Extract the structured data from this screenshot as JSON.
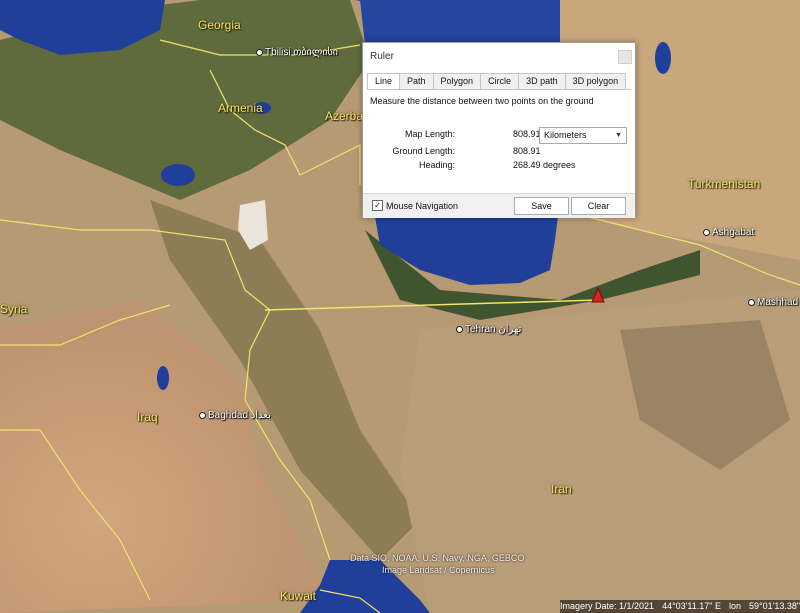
{
  "map": {
    "countries": [
      {
        "id": "georgia",
        "label": "Georgia"
      },
      {
        "id": "armenia",
        "label": "Armenia"
      },
      {
        "id": "azerbaijan",
        "label": "Azerba"
      },
      {
        "id": "turkmenistan",
        "label": "Turkmenistan"
      },
      {
        "id": "syria",
        "label": "Syria"
      },
      {
        "id": "iraq",
        "label": "Iraq"
      },
      {
        "id": "iran",
        "label": "Iran"
      },
      {
        "id": "kuwait",
        "label": "Kuwait"
      }
    ],
    "cities": [
      {
        "id": "tbilisi",
        "label": "Tbilisi თბილისი"
      },
      {
        "id": "ashgabat",
        "label": "Ashgabat"
      },
      {
        "id": "mashhad",
        "label": "Mashhad مشهد"
      },
      {
        "id": "tehran",
        "label": "Tehran تهران"
      },
      {
        "id": "baghdad",
        "label": "Baghdad بغداد"
      }
    ],
    "credits": {
      "line1": "Data SIO, NOAA, U.S. Navy, NGA, GEBCO",
      "line2": "Image Landsat / Copernicus"
    },
    "colors": {
      "water": "#1f3f9a",
      "land": "#b69a74",
      "mountains": "#6d7446",
      "border": "#f1e36b",
      "ruler_line": "#f1e36b",
      "marker": "#d2261f"
    }
  },
  "statusbar": {
    "imagery_date": "Imagery Date: 1/1/2021",
    "lat": "44°03'11.17\" E",
    "lon_label": "lon",
    "lon": "59°01'13.38\""
  },
  "ruler": {
    "title": "Ruler",
    "tabs": [
      "Line",
      "Path",
      "Polygon",
      "Circle",
      "3D path",
      "3D polygon"
    ],
    "active_tab": "Line",
    "description": "Measure the distance between two points on the ground",
    "map_length_label": "Map Length:",
    "map_length_value": "808.91",
    "unit": "Kilometers",
    "ground_length_label": "Ground Length:",
    "ground_length_value": "808.91",
    "heading_label": "Heading:",
    "heading_value": "268.49 degrees",
    "mouse_nav_label": "Mouse Navigation",
    "mouse_nav_checked": "✓",
    "save_label": "Save",
    "clear_label": "Clear"
  }
}
